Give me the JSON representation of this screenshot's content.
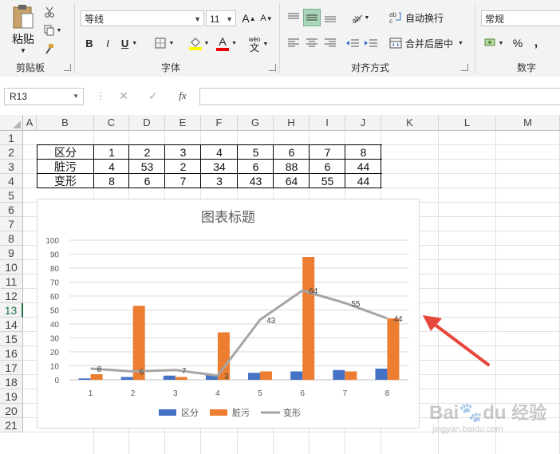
{
  "ribbon": {
    "clipboard": {
      "paste_label": "粘贴",
      "group_label": "剪贴板"
    },
    "font": {
      "font_name": "等线",
      "font_size": "11",
      "bold": "B",
      "italic": "I",
      "underline": "U",
      "font_color_glyph": "A",
      "phonetic_glyph_top": "wén",
      "phonetic_glyph_bottom": "文",
      "grow_glyph": "A",
      "shrink_glyph": "A",
      "group_label": "字体"
    },
    "alignment": {
      "wrap_text": "自动换行",
      "merge_center": "合并后居中",
      "group_label": "对齐方式"
    },
    "number": {
      "format": "常规",
      "percent": "%",
      "comma": ",",
      "group_label": "数字"
    }
  },
  "formula_bar": {
    "name_box": "R13",
    "cancel": "✕",
    "enter": "✓",
    "fx": "fx",
    "content": ""
  },
  "columns": [
    "A",
    "B",
    "C",
    "D",
    "E",
    "F",
    "G",
    "H",
    "I",
    "J",
    "K",
    "L",
    "M"
  ],
  "rows": [
    "1",
    "2",
    "3",
    "4",
    "5",
    "6",
    "7",
    "8",
    "9",
    "10",
    "11",
    "12",
    "13",
    "14",
    "15",
    "16",
    "17",
    "18",
    "19",
    "20",
    "21"
  ],
  "table": [
    [
      "区分",
      "1",
      "2",
      "3",
      "4",
      "5",
      "6",
      "7",
      "8"
    ],
    [
      "脏污",
      "4",
      "53",
      "2",
      "34",
      "6",
      "88",
      "6",
      "44"
    ],
    [
      "变形",
      "8",
      "6",
      "7",
      "3",
      "43",
      "64",
      "55",
      "44"
    ]
  ],
  "chart_data": {
    "type": "bar",
    "title": "图表标题",
    "categories": [
      "1",
      "2",
      "3",
      "4",
      "5",
      "6",
      "7",
      "8"
    ],
    "series": [
      {
        "name": "区分",
        "type": "bar",
        "color": "#4472c4",
        "values": [
          1,
          2,
          3,
          4,
          5,
          6,
          7,
          8
        ]
      },
      {
        "name": "脏污",
        "type": "bar",
        "color": "#ed7d31",
        "values": [
          4,
          53,
          2,
          34,
          6,
          88,
          6,
          44
        ]
      },
      {
        "name": "变形",
        "type": "line",
        "color": "#a5a5a5",
        "values": [
          8,
          6,
          7,
          3,
          43,
          64,
          55,
          44
        ],
        "data_labels": true
      }
    ],
    "ylim": [
      0,
      100
    ],
    "yticks": [
      0,
      10,
      20,
      30,
      40,
      50,
      60,
      70,
      80,
      90,
      100
    ],
    "grid": true,
    "legend": "bottom"
  },
  "annotation": {
    "color": "#e8473c"
  },
  "watermark": {
    "brand": "Bai",
    "paw": "du",
    "text": "经验",
    "url": "jingyan.baidu.com"
  }
}
